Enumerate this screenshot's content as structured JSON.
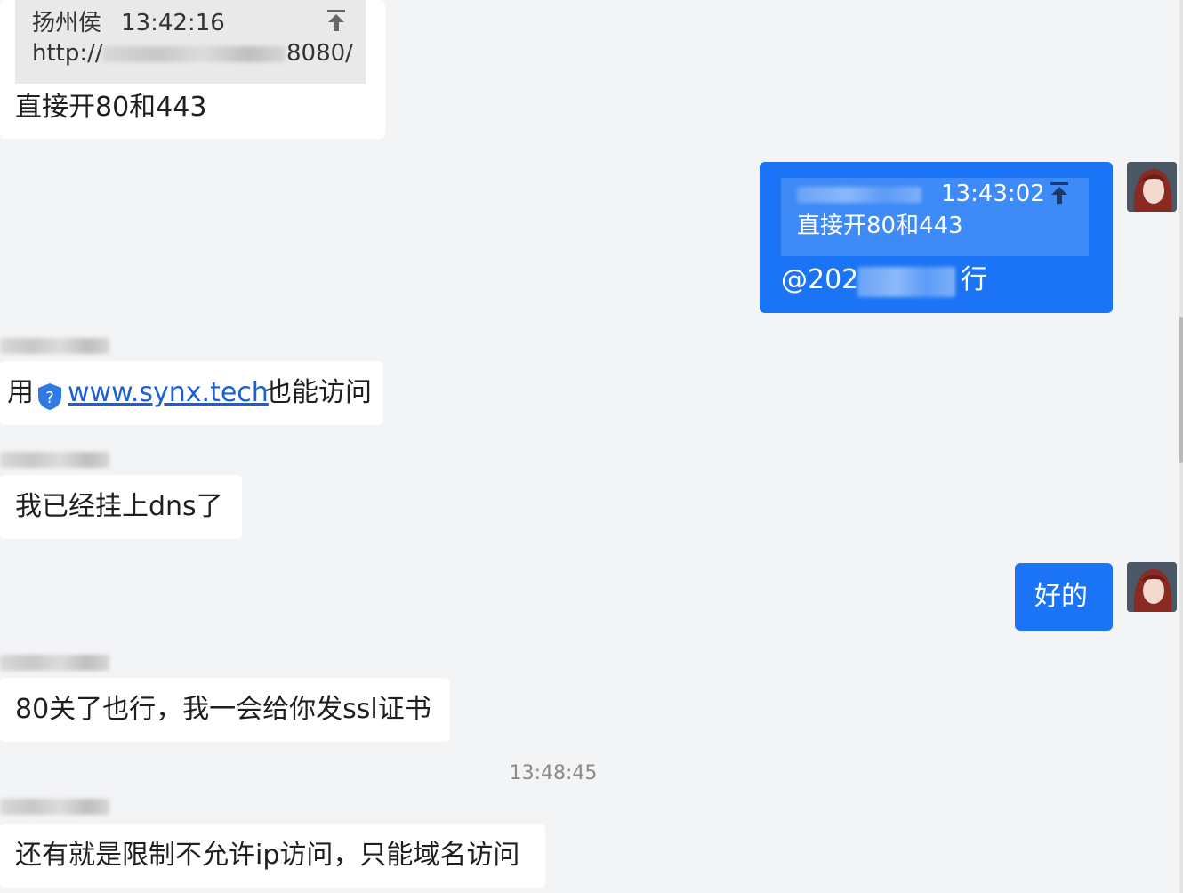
{
  "messages": {
    "m1": {
      "quote_sender": "扬州侯",
      "quote_time": "13:42:16",
      "quote_url_prefix": "http://",
      "quote_url_suffix": "8080/",
      "text": "直接开80和443"
    },
    "m2": {
      "quote_time": "13:43:02",
      "quote_text": "直接开80和443",
      "text_prefix": "@202",
      "text_suffix": "行"
    },
    "m3": {
      "prefix": "用",
      "link": "www.synx.tech",
      "suffix": "也能访问"
    },
    "m4": {
      "text": "我已经挂上dns了"
    },
    "m5": {
      "text": "好的"
    },
    "m6": {
      "text": "80关了也行，我一会给你发ssl证书"
    },
    "center_time": "13:48:45",
    "m7": {
      "text": "还有就是限制不允许ip访问，只能域名访问"
    }
  },
  "colors": {
    "background": "#f3f4f6",
    "bubble_left": "#ffffff",
    "bubble_right": "#1a74f5",
    "link": "#1a5fd6"
  },
  "icons": [
    "pin-icon",
    "shield-icon",
    "avatar"
  ]
}
